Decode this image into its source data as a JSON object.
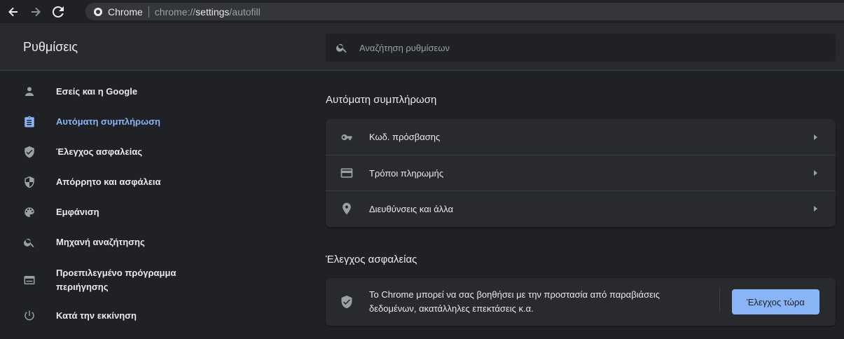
{
  "omnibox": {
    "site": "Chrome",
    "url_prefix": "chrome://",
    "url_host": "settings",
    "url_path": "/autofill"
  },
  "header": {
    "title": "Ρυθμίσεις",
    "search_placeholder": "Αναζήτηση ρυθμίσεων"
  },
  "sidebar": {
    "items": [
      {
        "label": "Εσείς και η Google",
        "icon": "person-icon"
      },
      {
        "label": "Αυτόματη συμπλήρωση",
        "icon": "clipboard-icon",
        "active": true
      },
      {
        "label": "Έλεγχος ασφαλείας",
        "icon": "shield-check-icon"
      },
      {
        "label": "Απόρρητο και ασφάλεια",
        "icon": "shield-half-icon"
      },
      {
        "label": "Εμφάνιση",
        "icon": "palette-icon"
      },
      {
        "label": "Μηχανή αναζήτησης",
        "icon": "search-icon"
      },
      {
        "label": "Προεπιλεγμένο πρόγραμμα περιήγησης",
        "icon": "browser-icon"
      },
      {
        "label": "Κατά την εκκίνηση",
        "icon": "power-icon"
      }
    ]
  },
  "autofill": {
    "title": "Αυτόματη συμπλήρωση",
    "rows": [
      {
        "label": "Κωδ. πρόσβασης",
        "icon": "key-icon"
      },
      {
        "label": "Τρόποι πληρωμής",
        "icon": "credit-card-icon"
      },
      {
        "label": "Διευθύνσεις και άλλα",
        "icon": "location-pin-icon"
      }
    ]
  },
  "safety": {
    "title": "Έλεγχος ασφαλείας",
    "text": "Το Chrome μπορεί να σας βοηθήσει με την προστασία από παραβιάσεις δεδομένων, ακατάλληλες επεκτάσεις κ.α.",
    "button_label": "Έλεγχος τώρα",
    "icon": "shield-check-icon"
  },
  "colors": {
    "accent": "#8ab4f8",
    "background": "#202124",
    "surface": "#292a2d",
    "icon": "#9aa0a6"
  }
}
